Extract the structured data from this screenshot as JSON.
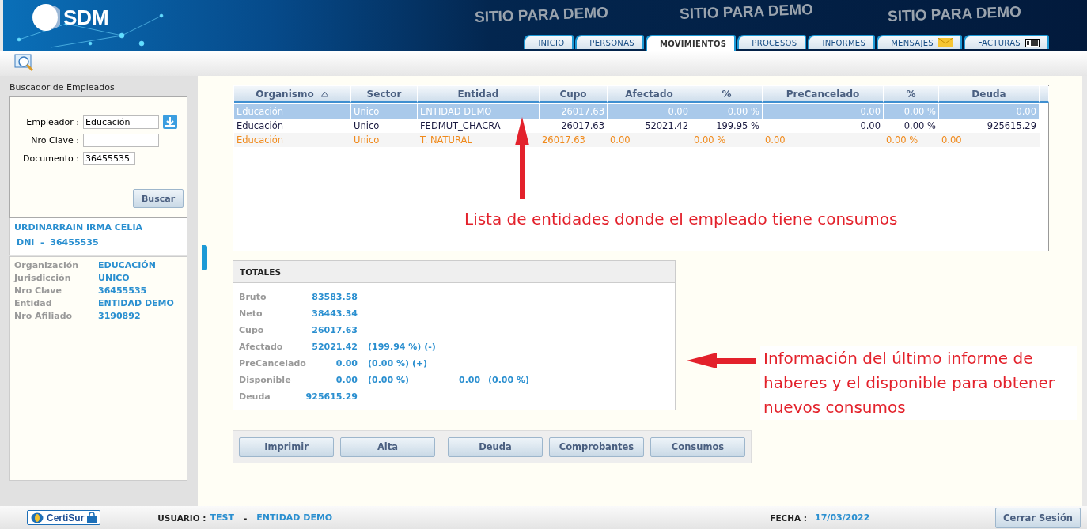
{
  "header": {
    "logo": "SDM",
    "watermarks": [
      "SITIO PARA DEMO",
      "SITIO PARA DEMO",
      "SITIO PARA DEMO"
    ],
    "tabs": [
      {
        "label": "INICIO",
        "selected": false,
        "kind": "plain"
      },
      {
        "label": "PERSONAS",
        "selected": false,
        "kind": "plain"
      },
      {
        "label": "MOVIMIENTOS",
        "selected": true,
        "kind": "plain"
      },
      {
        "label": "PROCESOS",
        "selected": false,
        "kind": "plain"
      },
      {
        "label": "INFORMES",
        "selected": false,
        "kind": "plain"
      },
      {
        "label": "MENSAJES",
        "selected": false,
        "kind": "mail"
      },
      {
        "label": "FACTURAS",
        "selected": false,
        "kind": "invoice"
      }
    ]
  },
  "sidebar": {
    "title": "Buscador de Empleados",
    "fields": [
      {
        "label": "Empleador :",
        "value": "Educación",
        "kind": "lookup"
      },
      {
        "label": "Nro Clave :",
        "kind": "short"
      },
      {
        "label": "Documento :",
        "value": "36455535",
        "kind": "medium"
      }
    ],
    "search_button": "Buscar",
    "employee_name": "URDINARRAIN IRMA CELIA",
    "employee_dni": "DNI  -  36455535",
    "details": [
      {
        "label": "Organización",
        "value": "EDUCACIÓN"
      },
      {
        "label": "Jurisdicción",
        "value": "UNICO"
      },
      {
        "label": "Nro Clave",
        "value": "36455535"
      },
      {
        "label": "Entidad",
        "value": "ENTIDAD DEMO"
      },
      {
        "label": "Nro Afiliado",
        "value": "3190892"
      }
    ]
  },
  "table": {
    "columns": [
      {
        "label": "Organismo",
        "sorted": true
      },
      {
        "label": "Sector",
        "sorted": false
      },
      {
        "label": "Entidad",
        "sorted": false
      },
      {
        "label": "Cupo",
        "sorted": false
      },
      {
        "label": "Afectado",
        "sorted": false
      },
      {
        "label": "%",
        "sorted": false
      },
      {
        "label": "PreCancelado",
        "sorted": false
      },
      {
        "label": "%",
        "sorted": false
      },
      {
        "label": "Deuda",
        "sorted": false
      }
    ],
    "rows": [
      {
        "selected": true,
        "kind": "normal",
        "cells": [
          "Educación",
          "Unico",
          "ENTIDAD DEMO",
          "26017.63",
          "0.00",
          "0.00 %",
          "0.00",
          "0.00 %",
          "0.00"
        ]
      },
      {
        "selected": false,
        "kind": "normal",
        "cells": [
          "Educación",
          "Unico",
          "FEDMUT_CHACRA",
          "26017.63",
          "52021.42",
          "199.95 %",
          "0.00",
          "0.00 %",
          "925615.29"
        ]
      },
      {
        "selected": false,
        "kind": "alert",
        "cells": [
          "Educación",
          "Unico",
          "T. NATURAL",
          "26017.63",
          "0.00",
          "0.00 %",
          "0.00",
          "0.00 %",
          "0.00"
        ]
      }
    ]
  },
  "totals": {
    "title": "TOTALES",
    "rows": [
      {
        "label": "Bruto",
        "value": "83583.58",
        "extras": []
      },
      {
        "label": "Neto",
        "value": "38443.34",
        "extras": []
      },
      {
        "label": "Cupo",
        "value": "26017.63",
        "extras": []
      },
      {
        "label": "Afectado",
        "value": "52021.42",
        "extras": [
          "(199.94 %) (-)"
        ]
      },
      {
        "label": "PreCancelado",
        "value": "0.00",
        "extras": [
          "(0.00 %) (+)"
        ]
      },
      {
        "label": "Disponible",
        "value": "0.00",
        "extras": [
          "(0.00 %)",
          "0.00",
          "(0.00 %)"
        ]
      },
      {
        "label": "Deuda",
        "value": "925615.29",
        "extras": []
      }
    ]
  },
  "actions": [
    "Imprimir",
    "Alta",
    "Deuda",
    "Comprobantes",
    "Consumos"
  ],
  "annotations": [
    {
      "text": "Lista de entidades donde el empleado tiene consumos",
      "kind": "up"
    },
    {
      "text": "Información del último informe de haberes y el disponible para obtener nuevos consumos",
      "kind": "left"
    }
  ],
  "footer": {
    "brand": "CertiSur",
    "user_label": "USUARIO :",
    "user": "TEST",
    "separator": "-",
    "entity": "ENTIDAD DEMO",
    "date_label": "FECHA :",
    "date": "17/03/2022",
    "logout": "Cerrar Sesión"
  }
}
